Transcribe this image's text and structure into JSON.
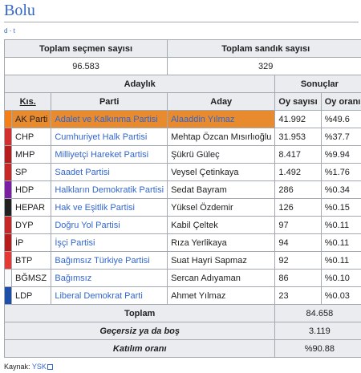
{
  "title": "Bolu",
  "view_links": {
    "v": "d",
    "sep": "·",
    "t": "t"
  },
  "summary_headers": {
    "voters": "Toplam seçmen sayısı",
    "boxes": "Toplam sandık sayısı"
  },
  "summary_values": {
    "voters": "96.583",
    "boxes": "329"
  },
  "group_headers": {
    "candidacy": "Adaylık",
    "results": "Sonuçlar"
  },
  "column_headers": {
    "abbr": "Kıs.",
    "party": "Parti",
    "candidate": "Aday",
    "votes": "Oy sayısı",
    "share": "Oy oranı"
  },
  "rows": [
    {
      "color": "#f57f17",
      "abbr": "AK Parti",
      "party": "Adalet ve Kalkınma Partisi",
      "candidate": "Alaaddin Yılmaz",
      "votes": "41.992",
      "share": "%49.6"
    },
    {
      "color": "#d32f2f",
      "abbr": "CHP",
      "party": "Cumhuriyet Halk Partisi",
      "candidate": "Mehtap Özcan Mısırlıoğlu",
      "votes": "31.953",
      "share": "%37.7"
    },
    {
      "color": "#b71c1c",
      "abbr": "MHP",
      "party": "Milliyetçi Hareket Partisi",
      "candidate": "Şükrü Güleç",
      "votes": "8.417",
      "share": "%9.94"
    },
    {
      "color": "#c62828",
      "abbr": "SP",
      "party": "Saadet Partisi",
      "candidate": "Veysel Çetinkaya",
      "votes": "1.492",
      "share": "%1.76"
    },
    {
      "color": "#7b1fa2",
      "abbr": "HDP",
      "party": "Halkların Demokratik Partisi",
      "candidate": "Sedat Bayram",
      "votes": "286",
      "share": "%0.34"
    },
    {
      "color": "#212121",
      "abbr": "HEPAR",
      "party": "Hak ve Eşitlik Partisi",
      "candidate": "Yüksel Özdemir",
      "votes": "126",
      "share": "%0.15"
    },
    {
      "color": "#c62828",
      "abbr": "DYP",
      "party": "Doğru Yol Partisi",
      "candidate": "Kabil Çeltek",
      "votes": "97",
      "share": "%0.11"
    },
    {
      "color": "#b71c1c",
      "abbr": "İP",
      "party": "İşçi Partisi",
      "candidate": "Rıza Yerlikaya",
      "votes": "94",
      "share": "%0.11"
    },
    {
      "color": "#e53935",
      "abbr": "BTP",
      "party": "Bağımsız Türkiye Partisi",
      "candidate": "Suat Hayri Sapmaz",
      "votes": "92",
      "share": "%0.11"
    },
    {
      "color": "#f8f9fa",
      "abbr": "BĞMSZ",
      "party": "Bağımsız",
      "candidate": "Sercan Adıyaman",
      "votes": "86",
      "share": "%0.10"
    },
    {
      "color": "#1e4fa8",
      "abbr": "LDP",
      "party": "Liberal Demokrat Parti",
      "candidate": "Ahmet Yılmaz",
      "votes": "23",
      "share": "%0.03"
    }
  ],
  "totals": [
    {
      "label": "Toplam",
      "value": "84.658",
      "italic": false
    },
    {
      "label": "Geçersiz ya da boş",
      "value": "3.119",
      "italic": true
    },
    {
      "label": "Katılım oranı",
      "value": "%90.88",
      "italic": true
    }
  ],
  "source": {
    "label": "Kaynak:",
    "link": "YSK"
  }
}
